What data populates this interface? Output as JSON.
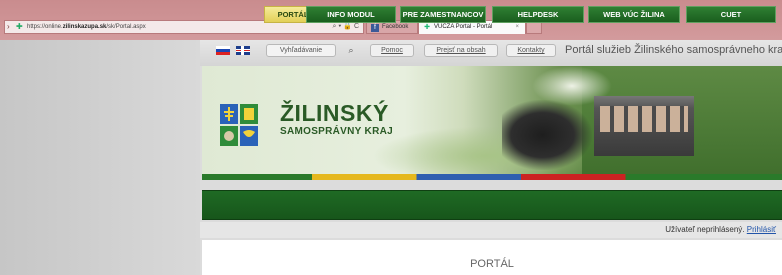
{
  "browser": {
    "address_url_prefix": "https://online.",
    "address_url_domain": "zilinskazupa.sk",
    "address_url_path": "/sk/Portal.aspx",
    "address_tools": "⌕ ▾ 🔒 C",
    "tabs": [
      {
        "label": "Facebook",
        "icon": "facebook-icon"
      },
      {
        "label": "VUCZA Portal - Portál",
        "icon": "site-favicon"
      }
    ],
    "tab_close": "×"
  },
  "topbar": {
    "search_placeholder": "Vyhľadávanie",
    "search_icon": "⌕",
    "links": {
      "pomoc": "Pomoc",
      "prejst": "Prejsť na obsah",
      "kontakty": "Kontakty"
    },
    "portal_title": "Portál služieb Žilinského samosprávneho kraja"
  },
  "brand": {
    "name": "ŽILINSKÝ",
    "subtitle": "SAMOSPRÁVNY KRAJ"
  },
  "menu": {
    "items": [
      {
        "label": "PORTÁL",
        "active": true
      },
      {
        "label": "INFO MODUL",
        "active": false
      },
      {
        "label": "PRE ZAMESTNANCOV",
        "active": false
      },
      {
        "label": "HELPDESK",
        "active": false
      },
      {
        "label": "WEB VÚC ŽILINA",
        "active": false
      },
      {
        "label": "CUET",
        "active": false
      }
    ]
  },
  "user": {
    "status": "Užívateľ neprihlásený.",
    "login": "Prihlásiť"
  },
  "content": {
    "title": "PORTÁL"
  },
  "colors": {
    "menu_green": "#1f6a24",
    "active_yellow": "#e3cf58",
    "brand_green": "#2a5a26"
  }
}
